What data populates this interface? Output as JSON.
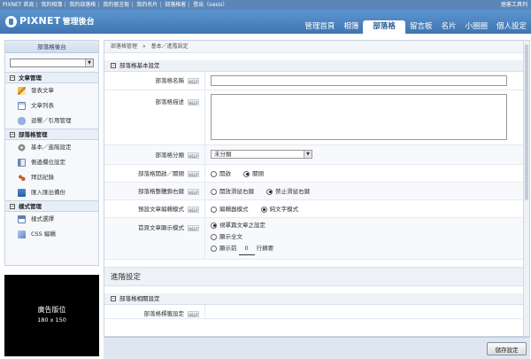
{
  "topbar": {
    "links": [
      "PIXNET 首頁",
      "我的相簿",
      "我的部落格",
      "我的留言板",
      "我的名片",
      "部落格客",
      "登出（oasis）"
    ],
    "toolbox": "痞客工具列"
  },
  "header": {
    "brand": "PIXNET",
    "subtitle": "管理後台",
    "tabs": [
      {
        "label": "管理首頁",
        "active": false
      },
      {
        "label": "相簿",
        "active": false
      },
      {
        "label": "部落格",
        "active": true
      },
      {
        "label": "留言板",
        "active": false
      },
      {
        "label": "名片",
        "active": false
      },
      {
        "label": "小圈圈",
        "active": false
      },
      {
        "label": "個人設定",
        "active": false
      }
    ]
  },
  "sidebar": {
    "title": "部落格後台",
    "sections": [
      {
        "title": "文章管理",
        "items": [
          {
            "label": "發表文章",
            "icon": "pencil-icon"
          },
          {
            "label": "文章列表",
            "icon": "document-list-icon"
          },
          {
            "label": "迴響／引用管理",
            "icon": "comment-icon"
          }
        ]
      },
      {
        "title": "部落格管理",
        "items": [
          {
            "label": "基本／進階設定",
            "icon": "gear-icon"
          },
          {
            "label": "側邊欄位設定",
            "icon": "sidebar-layout-icon"
          },
          {
            "label": "拜訪紀錄",
            "icon": "footprint-icon"
          },
          {
            "label": "匯入匯出備份",
            "icon": "import-export-icon"
          }
        ]
      },
      {
        "title": "樣式管理",
        "items": [
          {
            "label": "樣式選擇",
            "icon": "template-icon"
          },
          {
            "label": "CSS 編輯",
            "icon": "code-icon"
          }
        ]
      }
    ],
    "ad": {
      "line1": "廣告版位",
      "line2": "180 x 150"
    }
  },
  "main": {
    "breadcrumb": "部落格管理　»　基本／進階設定",
    "panel1_title": "部落格基本設定",
    "help_label": "HELP",
    "fields": {
      "name": {
        "label": "部落格名稱",
        "value": ""
      },
      "desc": {
        "label": "部落格描述",
        "value": ""
      },
      "category": {
        "label": "部落格分類",
        "value": "未分類"
      },
      "open_close": {
        "label": "部落格開啟／關閉",
        "options": [
          "開啟",
          "關閉"
        ],
        "selected": 1
      },
      "right_click": {
        "label": "部落格整體鎖右鍵",
        "options": [
          "開放滑鼠右鍵",
          "禁止滑鼠右鍵"
        ],
        "selected": 1
      },
      "editor_mode": {
        "label": "預設文章編輯模式",
        "options": [
          "編輯器模式",
          "純文字模式"
        ],
        "selected": 1
      },
      "index_display": {
        "label": "首頁文章顯示模式",
        "options": [
          "視單篇文章之設定",
          "顯示全文",
          "顯示前"
        ],
        "selected": 0,
        "lines_value": "0",
        "lines_suffix": "行摘要"
      }
    },
    "advanced_title": "進階設定",
    "panel2_title": "部落格相關設定",
    "partial_row_label": "部落格標籤設定"
  },
  "footer": {
    "save_label": "儲存設定"
  },
  "colors": {
    "header": "#4a80bc",
    "topbar": "#5b86b8",
    "accent": "#2f5f97"
  }
}
